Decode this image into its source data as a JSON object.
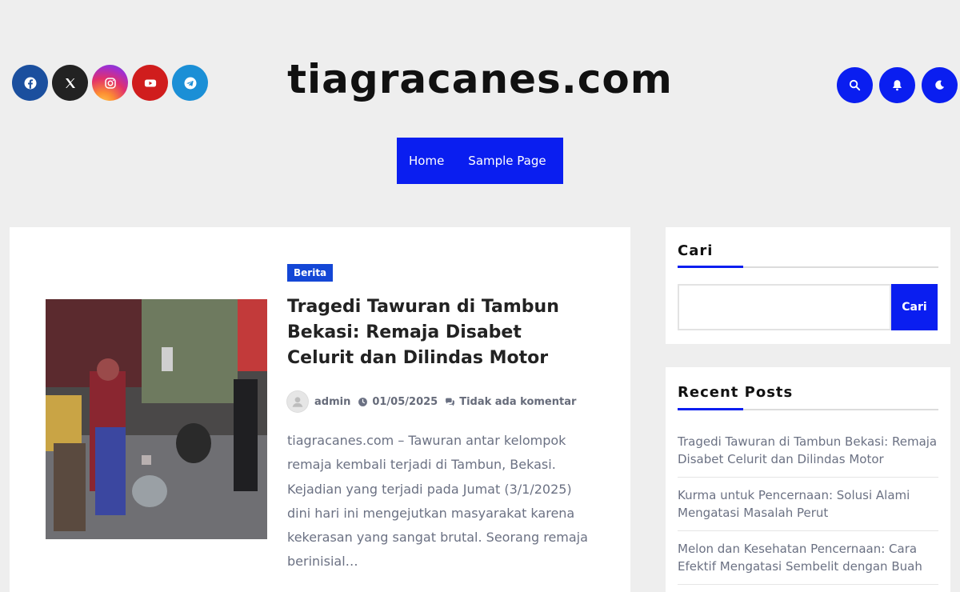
{
  "site": {
    "logo_text": "tiagracanes.com"
  },
  "social": {
    "items": [
      {
        "name": "facebook",
        "icon": "facebook-icon",
        "color": "#1b4f9e"
      },
      {
        "name": "x",
        "icon": "x-icon",
        "color": "#222222"
      },
      {
        "name": "instagram",
        "icon": "instagram-icon",
        "color": "#e1306c"
      },
      {
        "name": "youtube",
        "icon": "youtube-icon",
        "color": "#d01d1d"
      },
      {
        "name": "telegram",
        "icon": "telegram-icon",
        "color": "#1b8fd6"
      }
    ]
  },
  "header_actions": {
    "search_icon": "search-icon",
    "notification_icon": "bell-icon",
    "theme_icon": "moon-icon",
    "accent": "#0a1ef0"
  },
  "nav": {
    "items": [
      "Home",
      "Sample Page"
    ]
  },
  "post": {
    "category": "Berita",
    "title": "Tragedi Tawuran di Tambun Bekasi: Remaja Disabet Celurit dan Dilindas Motor",
    "author": "admin",
    "date": "01/05/2025",
    "comments": "Tidak ada komentar",
    "excerpt": "tiagracanes.com – Tawuran antar kelompok remaja kembali terjadi di Tambun, Bekasi. Kejadian yang terjadi pada Jumat (3/1/2025) dini hari ini mengejutkan masyarakat karena kekerasan yang sangat brutal. Seorang remaja berinisial…"
  },
  "sidebar": {
    "search": {
      "title": "Cari",
      "button": "Cari",
      "value": ""
    },
    "recent": {
      "title": "Recent Posts",
      "items": [
        "Tragedi Tawuran di Tambun Bekasi: Remaja Disabet Celurit dan Dilindas Motor",
        "Kurma untuk Pencernaan: Solusi Alami Mengatasi Masalah Perut",
        "Melon dan Kesehatan Pencernaan: Cara Efektif Mengatasi Sembelit dengan Buah"
      ]
    }
  }
}
